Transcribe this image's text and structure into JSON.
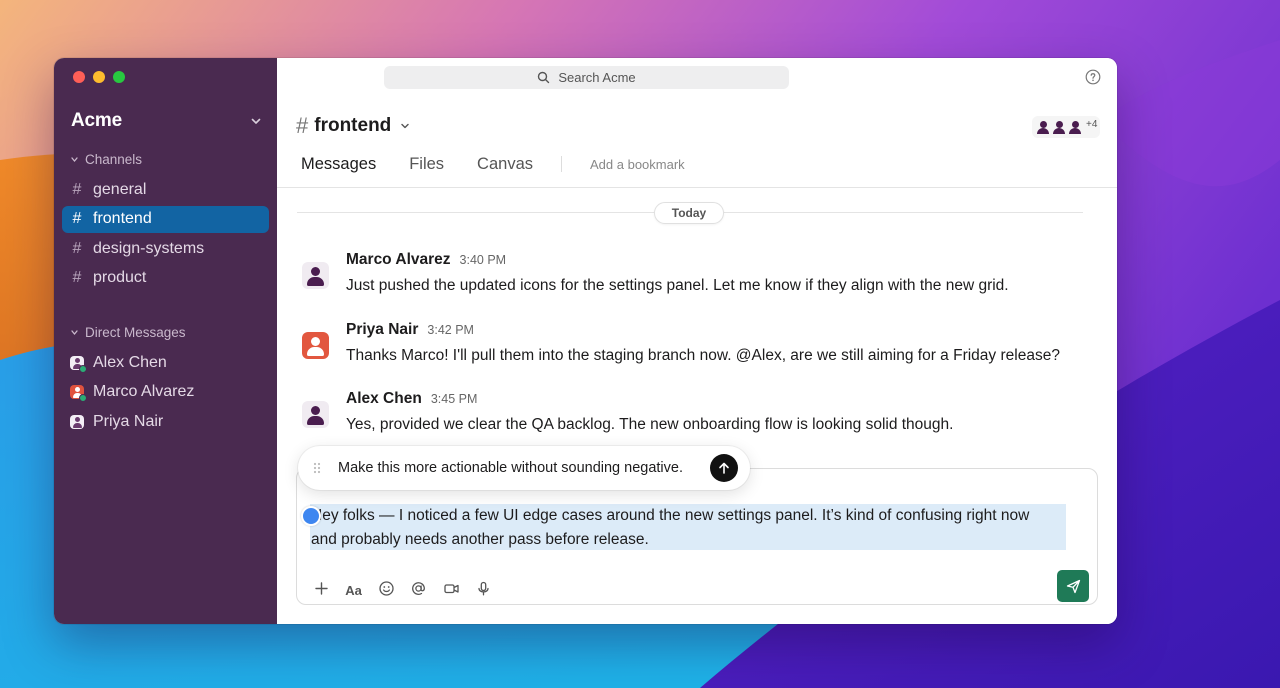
{
  "workspace": {
    "name": "Acme"
  },
  "sidebar": {
    "channels_header": "Channels",
    "channels": [
      {
        "label": "general",
        "active": false
      },
      {
        "label": "frontend",
        "active": true
      },
      {
        "label": "design-systems",
        "active": false
      },
      {
        "label": "product",
        "active": false
      }
    ],
    "dm_header": "Direct Messages",
    "dms": [
      {
        "label": "Alex Chen",
        "online": true
      },
      {
        "label": "Marco Alvarez",
        "online": true
      },
      {
        "label": "Priya Nair",
        "online": false
      }
    ]
  },
  "search": {
    "placeholder": "Search Acme"
  },
  "channel": {
    "hash": "#",
    "name": "frontend",
    "member_overflow": "+4"
  },
  "tabs": [
    {
      "label": "Messages",
      "active": true
    },
    {
      "label": "Files",
      "active": false
    },
    {
      "label": "Canvas",
      "active": false
    }
  ],
  "bookmark_label": "Add a bookmark",
  "day_divider": "Today",
  "messages": [
    {
      "author": "Marco Alvarez",
      "time": "3:40 PM",
      "text": "Just pushed the updated icons for the settings panel. Let me know if they align with the new grid."
    },
    {
      "author": "Priya Nair",
      "time": "3:42 PM",
      "text": "Thanks Marco! I'll pull them into the staging branch now. @Alex, are we still aiming for a Friday release?"
    },
    {
      "author": "Alex Chen",
      "time": "3:45 PM",
      "text": "Yes, provided we clear the QA backlog. The new onboarding flow is looking solid though."
    }
  ],
  "ai_prompt": {
    "text": "Make this more actionable without sounding negative."
  },
  "composer": {
    "draft_line1": "Hey folks — I noticed a few UI edge cases around the new settings panel. It’s kind of confusing right now",
    "draft_line2": "and probably needs another pass before release.",
    "format_label": "Aa"
  },
  "colors": {
    "sidebar_bg": "#4a2a50",
    "active_channel": "#1264a3",
    "send_button": "#1f7a57",
    "selection": "#dcebf8"
  }
}
